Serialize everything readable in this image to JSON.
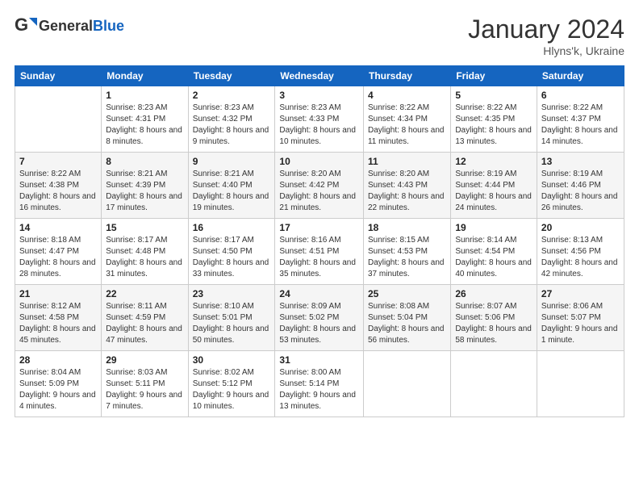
{
  "header": {
    "logo_general": "General",
    "logo_blue": "Blue",
    "month_title": "January 2024",
    "location": "Hlyns'k, Ukraine"
  },
  "days_of_week": [
    "Sunday",
    "Monday",
    "Tuesday",
    "Wednesday",
    "Thursday",
    "Friday",
    "Saturday"
  ],
  "weeks": [
    [
      {
        "day": "",
        "sunrise": "",
        "sunset": "",
        "daylight": ""
      },
      {
        "day": "1",
        "sunrise": "Sunrise: 8:23 AM",
        "sunset": "Sunset: 4:31 PM",
        "daylight": "Daylight: 8 hours and 8 minutes."
      },
      {
        "day": "2",
        "sunrise": "Sunrise: 8:23 AM",
        "sunset": "Sunset: 4:32 PM",
        "daylight": "Daylight: 8 hours and 9 minutes."
      },
      {
        "day": "3",
        "sunrise": "Sunrise: 8:23 AM",
        "sunset": "Sunset: 4:33 PM",
        "daylight": "Daylight: 8 hours and 10 minutes."
      },
      {
        "day": "4",
        "sunrise": "Sunrise: 8:22 AM",
        "sunset": "Sunset: 4:34 PM",
        "daylight": "Daylight: 8 hours and 11 minutes."
      },
      {
        "day": "5",
        "sunrise": "Sunrise: 8:22 AM",
        "sunset": "Sunset: 4:35 PM",
        "daylight": "Daylight: 8 hours and 13 minutes."
      },
      {
        "day": "6",
        "sunrise": "Sunrise: 8:22 AM",
        "sunset": "Sunset: 4:37 PM",
        "daylight": "Daylight: 8 hours and 14 minutes."
      }
    ],
    [
      {
        "day": "7",
        "sunrise": "Sunrise: 8:22 AM",
        "sunset": "Sunset: 4:38 PM",
        "daylight": "Daylight: 8 hours and 16 minutes."
      },
      {
        "day": "8",
        "sunrise": "Sunrise: 8:21 AM",
        "sunset": "Sunset: 4:39 PM",
        "daylight": "Daylight: 8 hours and 17 minutes."
      },
      {
        "day": "9",
        "sunrise": "Sunrise: 8:21 AM",
        "sunset": "Sunset: 4:40 PM",
        "daylight": "Daylight: 8 hours and 19 minutes."
      },
      {
        "day": "10",
        "sunrise": "Sunrise: 8:20 AM",
        "sunset": "Sunset: 4:42 PM",
        "daylight": "Daylight: 8 hours and 21 minutes."
      },
      {
        "day": "11",
        "sunrise": "Sunrise: 8:20 AM",
        "sunset": "Sunset: 4:43 PM",
        "daylight": "Daylight: 8 hours and 22 minutes."
      },
      {
        "day": "12",
        "sunrise": "Sunrise: 8:19 AM",
        "sunset": "Sunset: 4:44 PM",
        "daylight": "Daylight: 8 hours and 24 minutes."
      },
      {
        "day": "13",
        "sunrise": "Sunrise: 8:19 AM",
        "sunset": "Sunset: 4:46 PM",
        "daylight": "Daylight: 8 hours and 26 minutes."
      }
    ],
    [
      {
        "day": "14",
        "sunrise": "Sunrise: 8:18 AM",
        "sunset": "Sunset: 4:47 PM",
        "daylight": "Daylight: 8 hours and 28 minutes."
      },
      {
        "day": "15",
        "sunrise": "Sunrise: 8:17 AM",
        "sunset": "Sunset: 4:48 PM",
        "daylight": "Daylight: 8 hours and 31 minutes."
      },
      {
        "day": "16",
        "sunrise": "Sunrise: 8:17 AM",
        "sunset": "Sunset: 4:50 PM",
        "daylight": "Daylight: 8 hours and 33 minutes."
      },
      {
        "day": "17",
        "sunrise": "Sunrise: 8:16 AM",
        "sunset": "Sunset: 4:51 PM",
        "daylight": "Daylight: 8 hours and 35 minutes."
      },
      {
        "day": "18",
        "sunrise": "Sunrise: 8:15 AM",
        "sunset": "Sunset: 4:53 PM",
        "daylight": "Daylight: 8 hours and 37 minutes."
      },
      {
        "day": "19",
        "sunrise": "Sunrise: 8:14 AM",
        "sunset": "Sunset: 4:54 PM",
        "daylight": "Daylight: 8 hours and 40 minutes."
      },
      {
        "day": "20",
        "sunrise": "Sunrise: 8:13 AM",
        "sunset": "Sunset: 4:56 PM",
        "daylight": "Daylight: 8 hours and 42 minutes."
      }
    ],
    [
      {
        "day": "21",
        "sunrise": "Sunrise: 8:12 AM",
        "sunset": "Sunset: 4:58 PM",
        "daylight": "Daylight: 8 hours and 45 minutes."
      },
      {
        "day": "22",
        "sunrise": "Sunrise: 8:11 AM",
        "sunset": "Sunset: 4:59 PM",
        "daylight": "Daylight: 8 hours and 47 minutes."
      },
      {
        "day": "23",
        "sunrise": "Sunrise: 8:10 AM",
        "sunset": "Sunset: 5:01 PM",
        "daylight": "Daylight: 8 hours and 50 minutes."
      },
      {
        "day": "24",
        "sunrise": "Sunrise: 8:09 AM",
        "sunset": "Sunset: 5:02 PM",
        "daylight": "Daylight: 8 hours and 53 minutes."
      },
      {
        "day": "25",
        "sunrise": "Sunrise: 8:08 AM",
        "sunset": "Sunset: 5:04 PM",
        "daylight": "Daylight: 8 hours and 56 minutes."
      },
      {
        "day": "26",
        "sunrise": "Sunrise: 8:07 AM",
        "sunset": "Sunset: 5:06 PM",
        "daylight": "Daylight: 8 hours and 58 minutes."
      },
      {
        "day": "27",
        "sunrise": "Sunrise: 8:06 AM",
        "sunset": "Sunset: 5:07 PM",
        "daylight": "Daylight: 9 hours and 1 minute."
      }
    ],
    [
      {
        "day": "28",
        "sunrise": "Sunrise: 8:04 AM",
        "sunset": "Sunset: 5:09 PM",
        "daylight": "Daylight: 9 hours and 4 minutes."
      },
      {
        "day": "29",
        "sunrise": "Sunrise: 8:03 AM",
        "sunset": "Sunset: 5:11 PM",
        "daylight": "Daylight: 9 hours and 7 minutes."
      },
      {
        "day": "30",
        "sunrise": "Sunrise: 8:02 AM",
        "sunset": "Sunset: 5:12 PM",
        "daylight": "Daylight: 9 hours and 10 minutes."
      },
      {
        "day": "31",
        "sunrise": "Sunrise: 8:00 AM",
        "sunset": "Sunset: 5:14 PM",
        "daylight": "Daylight: 9 hours and 13 minutes."
      },
      {
        "day": "",
        "sunrise": "",
        "sunset": "",
        "daylight": ""
      },
      {
        "day": "",
        "sunrise": "",
        "sunset": "",
        "daylight": ""
      },
      {
        "day": "",
        "sunrise": "",
        "sunset": "",
        "daylight": ""
      }
    ]
  ]
}
